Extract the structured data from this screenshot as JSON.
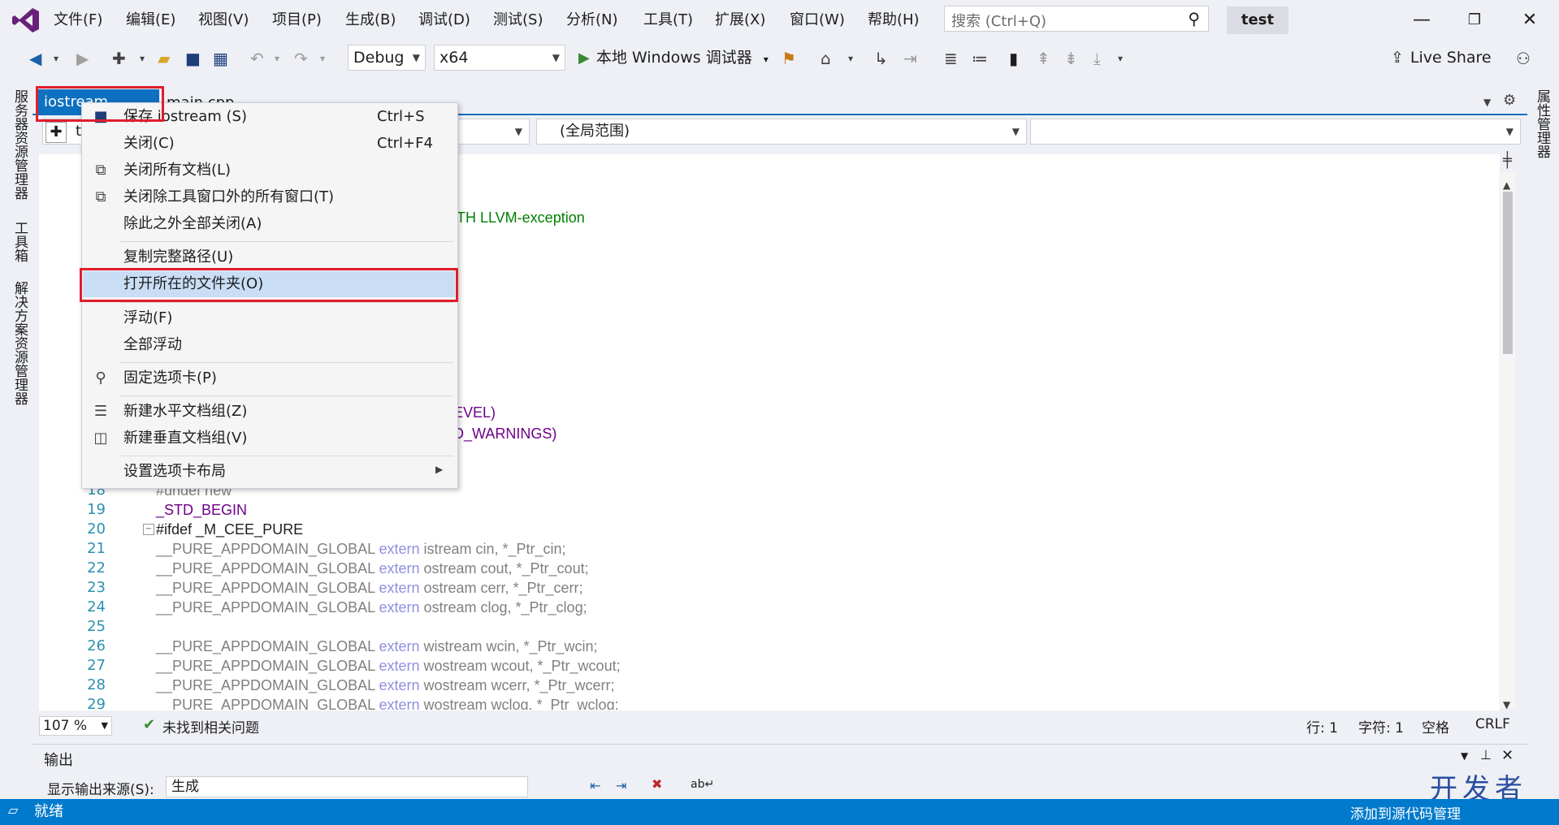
{
  "app": {
    "solution_name": "test"
  },
  "menubar": {
    "items": [
      "文件(F)",
      "编辑(E)",
      "视图(V)",
      "项目(P)",
      "生成(B)",
      "调试(D)",
      "测试(S)",
      "分析(N)",
      "工具(T)",
      "扩展(X)",
      "窗口(W)",
      "帮助(H)"
    ]
  },
  "search": {
    "placeholder": "搜索 (Ctrl+Q)"
  },
  "toolbar": {
    "config": "Debug",
    "platform": "x64",
    "run_label": "本地 Windows 调试器",
    "live_share": "Live Share"
  },
  "side_panels": {
    "left": [
      "服务器资源管理器",
      "工具箱",
      "解决方案资源管理器"
    ],
    "right": [
      "属性管理器"
    ]
  },
  "tabs": [
    {
      "label": "iostream",
      "active": true
    },
    {
      "label": "main.cpp",
      "active": false
    }
  ],
  "navbar": {
    "left": "t",
    "scope": "(全局范围)",
    "right": ""
  },
  "editor": {
    "visible_fragments": [
      {
        "text": "TH LLVM-exception"
      },
      {
        "text": "EVEL)"
      },
      {
        "text": "D_WARNINGS)"
      }
    ],
    "lines": [
      {
        "n": "18",
        "code": "#undef new"
      },
      {
        "n": "19",
        "code": "_STD_BEGIN"
      },
      {
        "n": "20",
        "code": "#ifdef _M_CEE_PURE"
      },
      {
        "n": "21",
        "code": "__PURE_APPDOMAIN_GLOBAL extern istream cin, *_Ptr_cin;"
      },
      {
        "n": "22",
        "code": "__PURE_APPDOMAIN_GLOBAL extern ostream cout, *_Ptr_cout;"
      },
      {
        "n": "23",
        "code": "__PURE_APPDOMAIN_GLOBAL extern ostream cerr, *_Ptr_cerr;"
      },
      {
        "n": "24",
        "code": "__PURE_APPDOMAIN_GLOBAL extern ostream clog, *_Ptr_clog;"
      },
      {
        "n": "25",
        "code": ""
      },
      {
        "n": "26",
        "code": "__PURE_APPDOMAIN_GLOBAL extern wistream wcin, *_Ptr_wcin;"
      },
      {
        "n": "27",
        "code": "__PURE_APPDOMAIN_GLOBAL extern wostream wcout, *_Ptr_wcout;"
      },
      {
        "n": "28",
        "code": "__PURE_APPDOMAIN_GLOBAL extern wostream wcerr, *_Ptr_wcerr;"
      },
      {
        "n": "29",
        "code": "__PURE_APPDOMAIN_GLOBAL extern wostream wclog, *_Ptr_wclog;"
      }
    ],
    "zoom": "107 %",
    "issues": "未找到相关问题",
    "line_info": "行: 1",
    "char_info": "字符: 1",
    "space_info": "空格",
    "eol": "CRLF"
  },
  "output": {
    "title": "输出",
    "source_label": "显示输出来源(S):",
    "source_value": "生成"
  },
  "status": {
    "text": "就绪",
    "right": "添加到源代码管理"
  },
  "context_menu": {
    "items": [
      {
        "label": "保存 iostream (S)",
        "shortcut": "Ctrl+S",
        "icon": "save-icon"
      },
      {
        "label": "关闭(C)",
        "shortcut": "Ctrl+F4",
        "icon": ""
      },
      {
        "label": "关闭所有文档(L)",
        "shortcut": "",
        "icon": "close-all-icon"
      },
      {
        "label": "关闭除工具窗口外的所有窗口(T)",
        "shortcut": "",
        "icon": "close-windows-icon"
      },
      {
        "label": "除此之外全部关闭(A)",
        "shortcut": "",
        "icon": ""
      },
      {
        "label": "复制完整路径(U)",
        "shortcut": "",
        "icon": ""
      },
      {
        "label": "打开所在的文件夹(O)",
        "shortcut": "",
        "icon": "",
        "highlighted": true
      },
      {
        "label": "浮动(F)",
        "shortcut": "",
        "icon": ""
      },
      {
        "label": "全部浮动",
        "shortcut": "",
        "icon": ""
      },
      {
        "label": "固定选项卡(P)",
        "shortcut": "",
        "icon": "pin-icon"
      },
      {
        "label": "新建水平文档组(Z)",
        "shortcut": "",
        "icon": "horizontal-group-icon"
      },
      {
        "label": "新建垂直文档组(V)",
        "shortcut": "",
        "icon": "vertical-group-icon"
      },
      {
        "label": "设置选项卡布局",
        "shortcut": "",
        "icon": "submenu-arrow-icon"
      }
    ]
  },
  "watermark": "开发者"
}
